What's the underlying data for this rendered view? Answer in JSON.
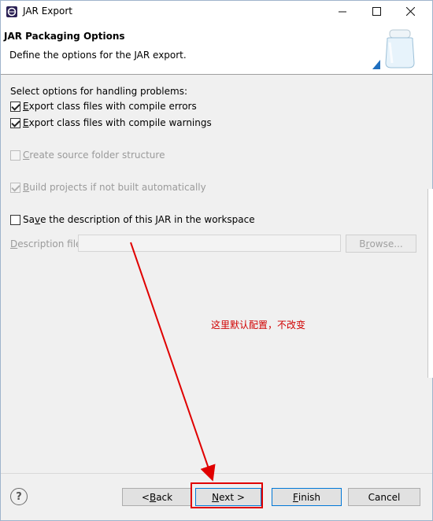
{
  "window": {
    "title": "JAR Export",
    "controls": {
      "minimize": "—",
      "maximize": "☐",
      "close": "✕"
    }
  },
  "header": {
    "title": "JAR Packaging Options",
    "description": "Define the options for the JAR export."
  },
  "options": {
    "group_label": "Select options for handling problems:",
    "export_errors": {
      "label_pre": "",
      "label_mnemonic": "E",
      "label_post": "xport class files with compile errors",
      "checked": true
    },
    "export_warnings": {
      "label_pre": "",
      "label_mnemonic": "E",
      "label_post": "xport class files with compile warnings",
      "checked": true
    },
    "source_folder": {
      "label_pre": "",
      "label_mnemonic": "C",
      "label_post": "reate source folder structure",
      "checked": false,
      "disabled": true
    },
    "build_projects": {
      "label_pre": "",
      "label_mnemonic": "B",
      "label_post": "uild projects if not built automatically",
      "checked": true,
      "disabled": true
    },
    "save_description": {
      "label_pre": "Sa",
      "label_mnemonic": "v",
      "label_post": "e the description of this JAR in the workspace",
      "checked": false
    }
  },
  "description_file": {
    "label_pre": "",
    "label_mnemonic": "D",
    "label_post": "escription file:",
    "value": "",
    "browse_pre": "B",
    "browse_mnemonic": "r",
    "browse_post": "owse..."
  },
  "annotation": {
    "note": "这里默认配置，不改变",
    "color": "#e00000"
  },
  "footer": {
    "help": "?",
    "back": {
      "pre": "< ",
      "mnemonic": "B",
      "post": "ack"
    },
    "next": {
      "pre": "",
      "mnemonic": "N",
      "post": "ext >"
    },
    "finish": {
      "pre": "",
      "mnemonic": "F",
      "post": "inish"
    },
    "cancel": "Cancel"
  }
}
